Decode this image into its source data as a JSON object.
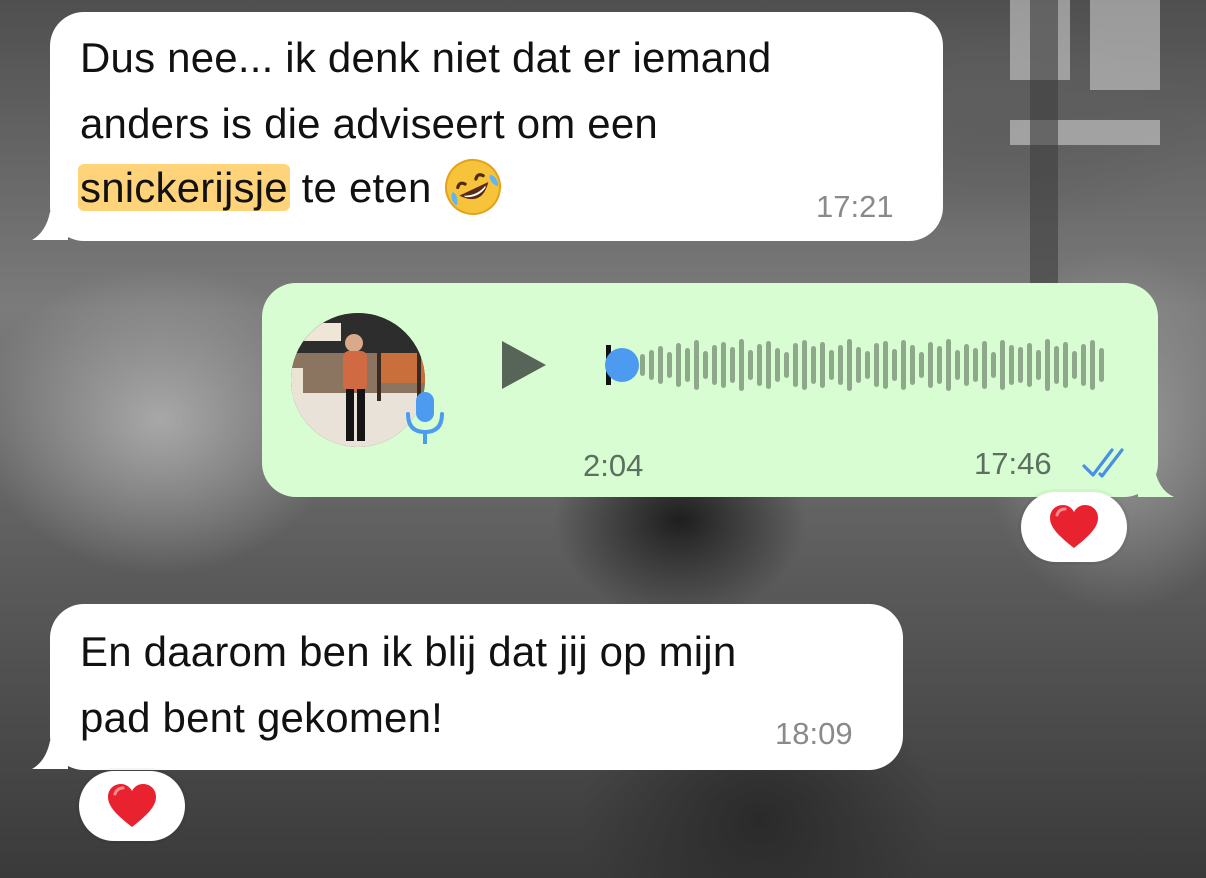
{
  "messages": [
    {
      "direction": "incoming",
      "text_before": "Dus nee... ik denk niet dat er iemand anders is die adviseert om een ",
      "line1": "Dus nee... ik denk niet dat er iemand",
      "line2": "anders is die adviseert om een",
      "highlight": "snickerijsje",
      "line3_after": " te eten",
      "emoji": "rolling-on-floor-laughing-emoji",
      "time": "17:21"
    },
    {
      "direction": "outgoing",
      "type": "voice",
      "duration": "2:04",
      "time": "17:46",
      "status": "read",
      "playback_progress": 0.0,
      "reaction": "red-heart"
    },
    {
      "direction": "incoming",
      "line1": "En daarom ben ik blij dat jij op mijn",
      "line2": "pad bent gekomen!",
      "time": "18:09",
      "reaction": "red-heart"
    }
  ],
  "colors": {
    "incoming_bubble": "#ffffff",
    "outgoing_bubble": "#d9fdd3",
    "highlight": "#ffd37a",
    "read_ticks": "#4a90e2",
    "waveform": "#8fa88c",
    "progress_dot": "#4c9bf0"
  }
}
